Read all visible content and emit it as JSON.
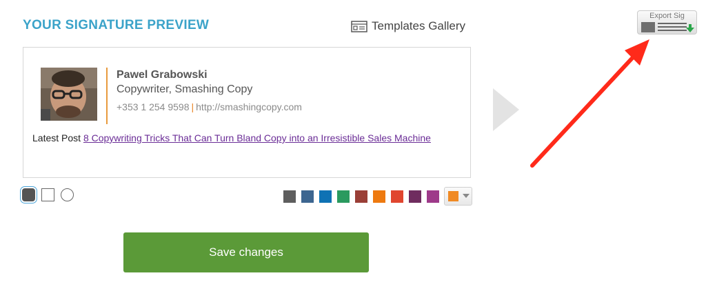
{
  "header": {
    "title": "YOUR SIGNATURE PREVIEW",
    "templates_link": "Templates Gallery"
  },
  "signature": {
    "name": "Pawel Grabowski",
    "role": "Copywriter, Smashing Copy",
    "phone": "+353 1 254 9598",
    "separator": "|",
    "website": "http://smashingcopy.com",
    "latest_post_label": "Latest Post",
    "latest_post_title": "8 Copywriting Tricks That Can Turn Bland Copy into an Irresistible Sales Machine",
    "accent_color": "#e89a3c",
    "link_color": "#6a2c96"
  },
  "layout_options": [
    {
      "name": "rounded-square",
      "selected": true
    },
    {
      "name": "square",
      "selected": false
    },
    {
      "name": "circle",
      "selected": false
    }
  ],
  "color_swatches": [
    "#5e5e5e",
    "#3d6690",
    "#0f72b4",
    "#2a9a5f",
    "#9a3f37",
    "#ee7a10",
    "#e0462f",
    "#6f2c5f",
    "#9e3a8a"
  ],
  "color_picker": {
    "selected_color": "#f08a24",
    "icon": "chevron-down-icon"
  },
  "save_button": {
    "label": "Save changes",
    "color": "#5b9a38"
  },
  "export": {
    "label": "Export Sig",
    "icon": "export-download-icon"
  },
  "annotation": {
    "color": "#ff2a1a",
    "icon": "red-arrow-icon"
  },
  "title_color": "#3ba3c9"
}
